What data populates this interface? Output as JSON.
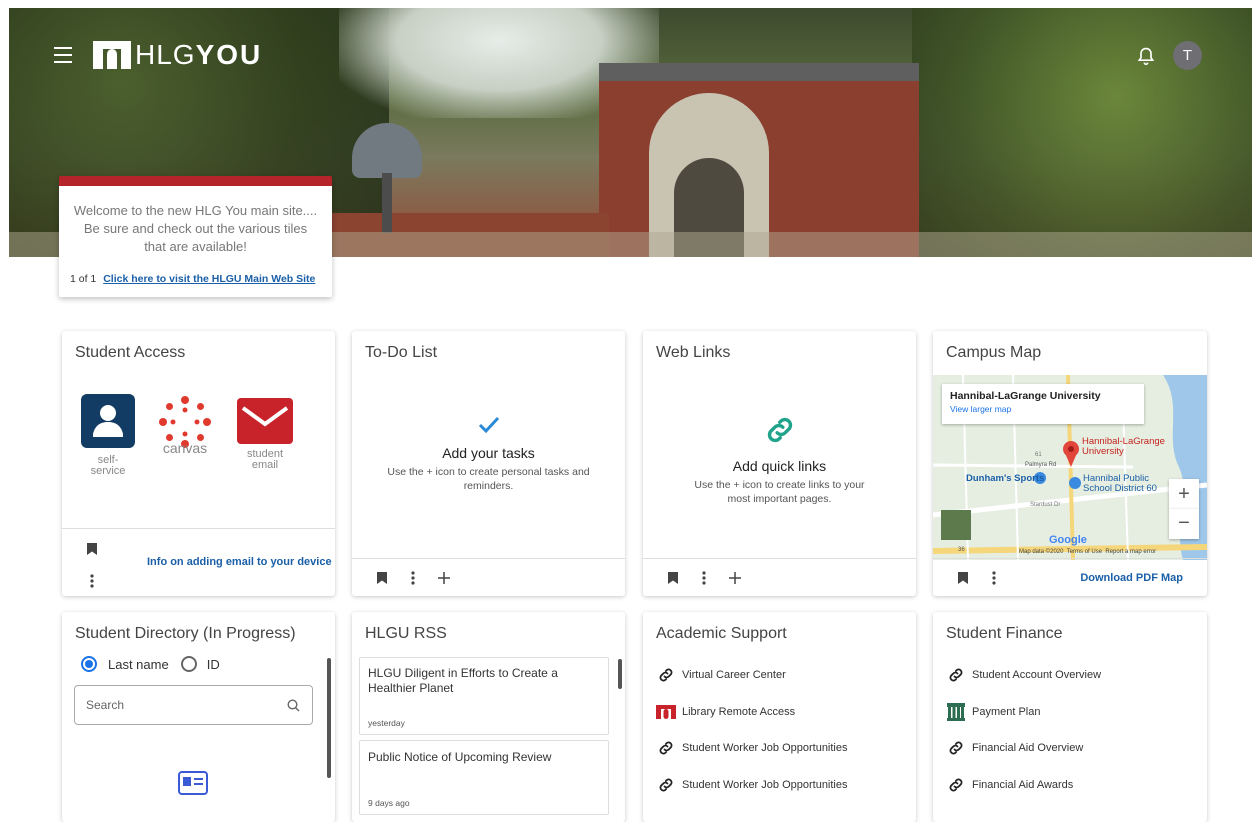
{
  "header": {
    "logo_text_light": "HLG",
    "logo_text_bold": "YOU",
    "avatar_initial": "T"
  },
  "announcement": {
    "message": "Welcome to the new HLG You main site.... Be sure and check out the various tiles that are available!",
    "pager": "1 of 1",
    "link_label": "Click here to visit the HLGU Main Web Site",
    "accent_color": "#b5232b"
  },
  "cards": {
    "student_access": {
      "title": "Student Access",
      "apps": [
        {
          "label": "self-\nservice",
          "icon": "person-badge-icon"
        },
        {
          "label": "canvas",
          "icon": "canvas-logo-icon"
        },
        {
          "label": "student\nemail",
          "icon": "envelope-icon"
        }
      ],
      "footer_link": "Info on adding email to your device"
    },
    "todo": {
      "title": "To-Do List",
      "empty_heading": "Add your tasks",
      "empty_text": "Use the + icon to create personal tasks and reminders."
    },
    "web_links": {
      "title": "Web Links",
      "empty_heading": "Add quick links",
      "empty_text": "Use the + icon to create links to your most important pages."
    },
    "campus_map": {
      "title": "Campus Map",
      "place_name": "Hannibal-LaGrange University",
      "view_larger": "View larger map",
      "pin_label": "Hannibal-LaGrange University",
      "poi_1": "Dunham's Sports",
      "poi_2": "Hannibal Public School District 60",
      "road_1": "Palmyra Rd",
      "road_2": "Stardust Dr",
      "route_badge": "61",
      "route_badge_2": "36",
      "google": "Google",
      "map_data": "Map data ©2020",
      "terms": "Terms of Use",
      "report": "Report a map error",
      "footer_link": "Download PDF Map"
    },
    "directory": {
      "title": "Student Directory (In Progress)",
      "radio_1": "Last name",
      "radio_2": "ID",
      "search_placeholder": "Search"
    },
    "rss": {
      "title": "HLGU RSS",
      "items": [
        {
          "title": "HLGU Diligent in Efforts to Create a Healthier Planet",
          "date": "yesterday"
        },
        {
          "title": "Public Notice of Upcoming Review",
          "date": "9 days ago"
        }
      ]
    },
    "academic": {
      "title": "Academic Support",
      "links": [
        "Virtual Career Center",
        "Library Remote Access",
        "Student Worker Job Opportunities",
        "Student Worker Job Opportunities"
      ]
    },
    "finance": {
      "title": "Student Finance",
      "links": [
        "Student Account Overview",
        "Payment Plan",
        "Financial Aid Overview",
        "Financial Aid Awards"
      ]
    }
  },
  "colors": {
    "teal_link_icon": "#1fa38a",
    "todo_check": "#2a8ad8",
    "link_blue": "#1a5fa8",
    "selfservice_navy": "#123c63",
    "email_red": "#c8222b",
    "directory_icon": "#3b5bd6"
  }
}
